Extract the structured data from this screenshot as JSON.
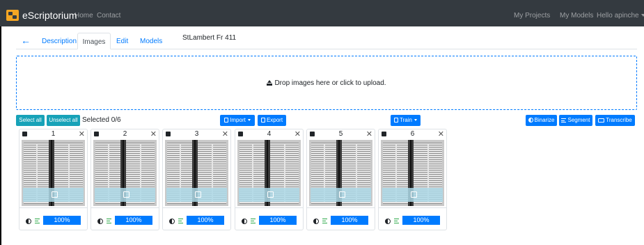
{
  "navbar": {
    "brand": "eScriptorium",
    "links": [
      "Home",
      "Contact"
    ],
    "right_links": [
      "My Projects",
      "My Models"
    ],
    "user_menu": "Hello apinche"
  },
  "tabs": {
    "items": [
      "Description",
      "Images",
      "Edit",
      "Models"
    ],
    "active": "Images",
    "document_title": "StLambert Fr 411"
  },
  "dropzone": {
    "text": "Drop images here or click to upload."
  },
  "toolbar": {
    "select_all": "Select all",
    "unselect_all": "Unselect all",
    "selected_count": "Selected 0/6",
    "import": "Import",
    "export": "Export",
    "train": "Train",
    "binarize": "Binarize",
    "segment": "Segment",
    "transcribe": "Transcribe"
  },
  "cards": [
    {
      "number": "1",
      "progress": "100%"
    },
    {
      "number": "2",
      "progress": "100%"
    },
    {
      "number": "3",
      "progress": "100%"
    },
    {
      "number": "4",
      "progress": "100%"
    },
    {
      "number": "5",
      "progress": "100%"
    },
    {
      "number": "6",
      "progress": "100%"
    }
  ],
  "colors": {
    "navbar": "#343a40",
    "primary": "#007bff",
    "info": "#17a2b8",
    "success": "#28a745"
  },
  "icons": [
    "escriptorium-logo-icon",
    "back-arrow-icon",
    "upload-icon",
    "import-icon",
    "export-icon",
    "train-icon",
    "binarize-icon",
    "segment-icon",
    "transcribe-icon",
    "close-icon",
    "edit-icon",
    "contrast-icon"
  ]
}
